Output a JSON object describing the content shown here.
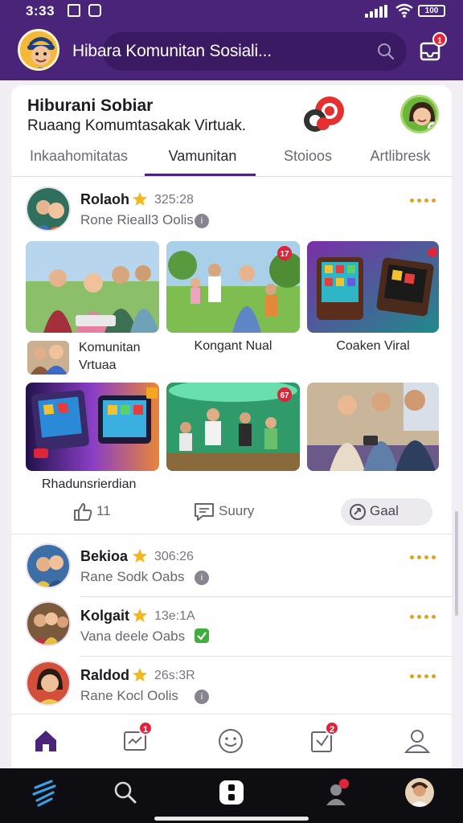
{
  "status": {
    "time": "3:33",
    "battery": "100"
  },
  "appbar": {
    "title": "Hibara Komunitan Sosiali...",
    "inbox_badge": "1"
  },
  "header": {
    "title": "Hiburani Sobiar",
    "subtitle": "Ruaang Komumtasakak Virtuak."
  },
  "tabs": [
    {
      "label": "Inkaahomitatas"
    },
    {
      "label": "Vamunitan"
    },
    {
      "label": "Stoioos"
    },
    {
      "label": "Artlibresk"
    }
  ],
  "post": {
    "name": "Rolaoh",
    "time": "325:28",
    "meta": "Rone Rieall3 Oolis",
    "tiles": [
      {
        "label": "Komunitan Vrtuaa"
      },
      {
        "label": "Kongant Nual",
        "badge": "17"
      },
      {
        "label": "Coaken Viral"
      },
      {
        "label": "Rhadunsrierdian",
        "badge": ""
      },
      {
        "label": "",
        "badge": "67"
      },
      {
        "label": ""
      }
    ],
    "like_count": "11",
    "comment_label": "Suury",
    "share_label": "Gaal"
  },
  "feed": [
    {
      "name": "Bekioa",
      "time": "306:26",
      "meta": "Rane Sodk Oabs",
      "verified": false
    },
    {
      "name": "Kolgait",
      "time": "13e:1A",
      "meta": "Vana deele Oabs",
      "verified": true
    },
    {
      "name": "Raldod",
      "time": "26s:3R",
      "meta": "Rane Kocl Oolis",
      "verified": false
    }
  ],
  "bottom_nav": {
    "badge_1": "1",
    "badge_2": "2"
  },
  "colors": {
    "brand": "#4a2478",
    "accent": "#e2a21c",
    "badge": "#e0243a",
    "verified": "#3fae3f"
  }
}
